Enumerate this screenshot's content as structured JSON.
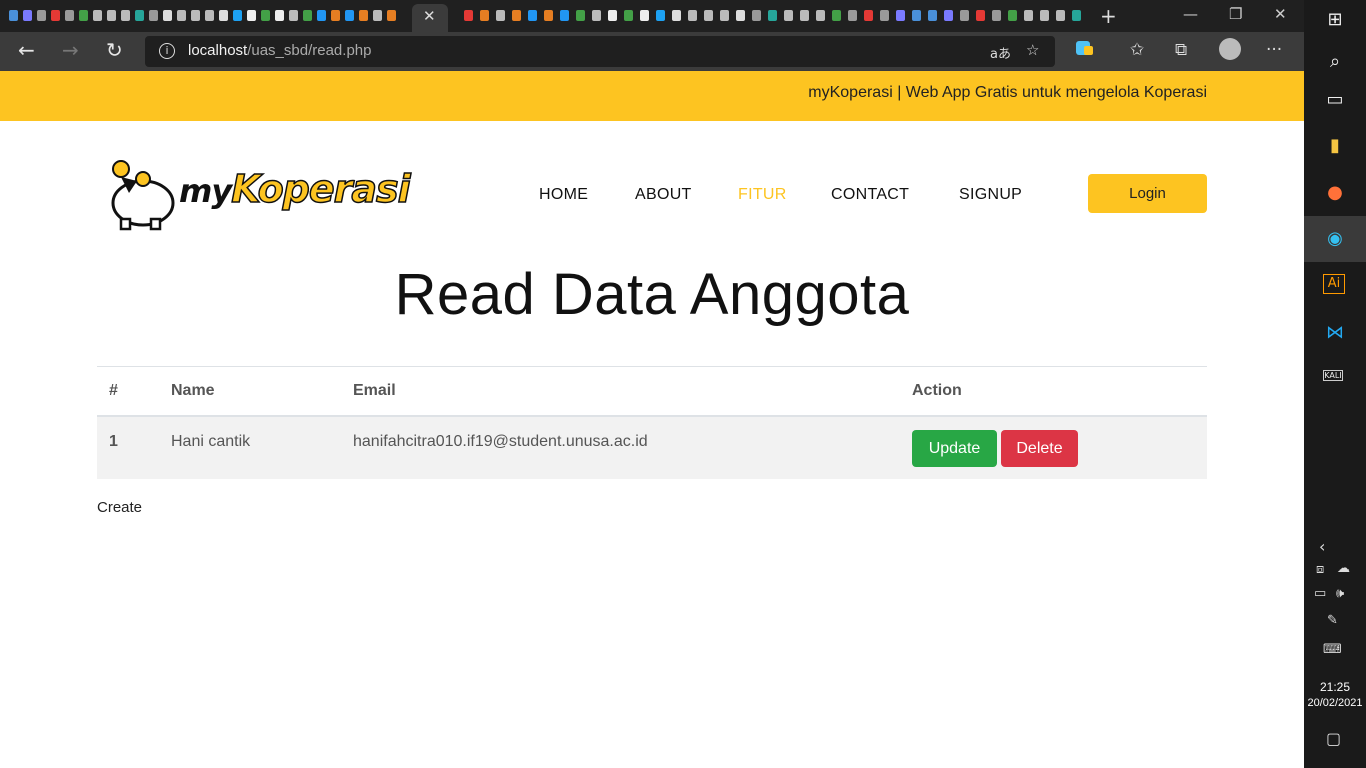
{
  "browser": {
    "url_host": "localhost",
    "url_path": "/uas_sbd/read.php",
    "tab_close_glyph": "✕",
    "new_tab_glyph": "+",
    "back_glyph": "←",
    "forward_glyph": "→",
    "reload_glyph": "↻",
    "tab_favicon_colors": [
      "#4a90d9",
      "#7a7aff",
      "#9a9a9a",
      "#e53935",
      "#9a9a9a",
      "#43a047",
      "#bbbbbb",
      "#bbbbbb",
      "#bbbbbb",
      "#26a69a",
      "#9a9a9a",
      "#dddddd",
      "#bbbbbb",
      "#bbbbbb",
      "#bbbbbb",
      "#dddddd",
      "#1da1f2",
      "#eeeeee",
      "#43a047",
      "#eeeeee",
      "#bbbbbb",
      "#43a047",
      "#2196f3",
      "#e67e22",
      "#2196f3",
      "#e67e22",
      "#bbbbbb",
      "#e67e22",
      "#e53935"
    ]
  },
  "site": {
    "topbar_text": "myKoperasi | Web App Gratis untuk mengelola Koperasi",
    "logo": {
      "part1": "my",
      "part2": "Koperasi"
    },
    "nav": [
      "HOME",
      "ABOUT",
      "FITUR",
      "CONTACT",
      "SIGNUP"
    ],
    "active_nav": "FITUR",
    "login_label": "Login",
    "accent_color": "#fdc421"
  },
  "page": {
    "title": "Read Data Anggota",
    "table": {
      "headers": [
        "#",
        "Name",
        "Email",
        "Action"
      ],
      "rows": [
        {
          "no": "1",
          "name": "Hani cantik",
          "email": "hanifahcitra010.if19@student.unusa.ac.id"
        }
      ],
      "update_label": "Update",
      "delete_label": "Delete"
    },
    "create_label": "Create"
  },
  "taskbar": {
    "time": "21:25",
    "date": "20/02/2021"
  }
}
